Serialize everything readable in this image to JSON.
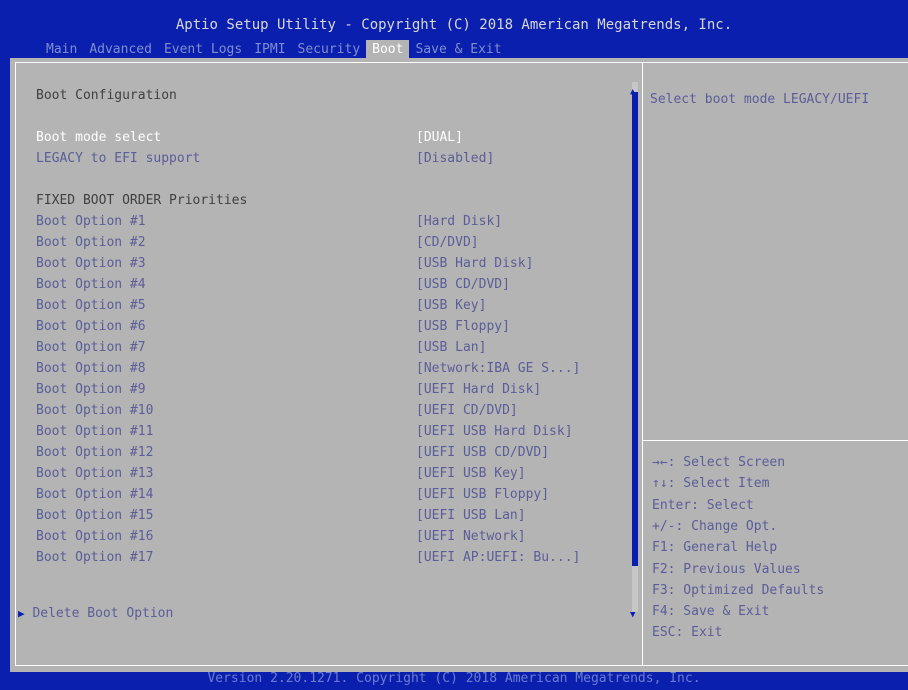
{
  "header": {
    "title": "Aptio Setup Utility - Copyright (C) 2018 American Megatrends, Inc.",
    "tabs": [
      "Main",
      "Advanced",
      "Event Logs",
      "IPMI",
      "Security",
      "Boot",
      "Save & Exit"
    ],
    "active_tab": "Boot"
  },
  "main": {
    "section_title": "Boot Configuration",
    "boot_mode": {
      "label": "Boot mode select",
      "value": "[DUAL]"
    },
    "legacy_efi": {
      "label": "LEGACY to EFI support",
      "value": "[Disabled]"
    },
    "priorities_title": "FIXED BOOT ORDER Priorities",
    "options": [
      {
        "label": "Boot Option #1",
        "value": "[Hard Disk]"
      },
      {
        "label": "Boot Option #2",
        "value": "[CD/DVD]"
      },
      {
        "label": "Boot Option #3",
        "value": "[USB Hard Disk]"
      },
      {
        "label": "Boot Option #4",
        "value": "[USB CD/DVD]"
      },
      {
        "label": "Boot Option #5",
        "value": "[USB Key]"
      },
      {
        "label": "Boot Option #6",
        "value": "[USB Floppy]"
      },
      {
        "label": "Boot Option #7",
        "value": "[USB Lan]"
      },
      {
        "label": "Boot Option #8",
        "value": "[Network:IBA GE S...]"
      },
      {
        "label": "Boot Option #9",
        "value": "[UEFI Hard Disk]"
      },
      {
        "label": "Boot Option #10",
        "value": "[UEFI CD/DVD]"
      },
      {
        "label": "Boot Option #11",
        "value": "[UEFI USB Hard Disk]"
      },
      {
        "label": "Boot Option #12",
        "value": "[UEFI USB CD/DVD]"
      },
      {
        "label": "Boot Option #13",
        "value": "[UEFI USB Key]"
      },
      {
        "label": "Boot Option #14",
        "value": "[UEFI USB Floppy]"
      },
      {
        "label": "Boot Option #15",
        "value": "[UEFI USB Lan]"
      },
      {
        "label": "Boot Option #16",
        "value": "[UEFI Network]"
      },
      {
        "label": "Boot Option #17",
        "value": "[UEFI AP:UEFI: Bu...]"
      }
    ],
    "delete_option": "Delete Boot Option"
  },
  "help": {
    "description": "Select boot mode LEGACY/UEFI",
    "keys": [
      "→←: Select Screen",
      "↑↓: Select Item",
      "Enter: Select",
      "+/-: Change Opt.",
      "F1: General Help",
      "F2: Previous Values",
      "F3: Optimized Defaults",
      "F4: Save & Exit",
      "ESC: Exit"
    ]
  },
  "footer": "Version 2.20.1271. Copyright (C) 2018 American Megatrends, Inc.",
  "colors": {
    "background": "#0a1fae",
    "panel": "#b4b4b4",
    "text_blue": "#5b5d98",
    "text_white": "#ffffff"
  }
}
